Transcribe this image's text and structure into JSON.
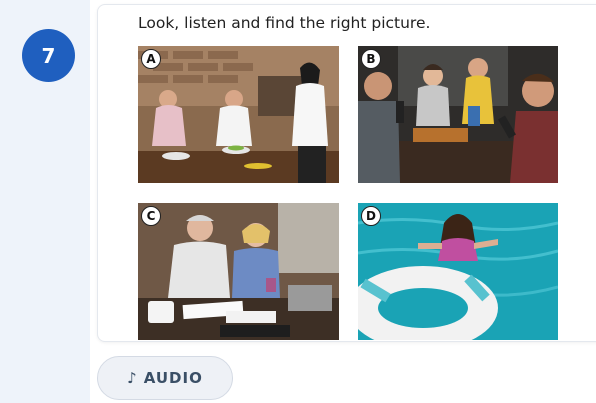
{
  "question": {
    "number": "7",
    "instruction": "Look, listen and find the right picture."
  },
  "pictures": [
    {
      "letter": "A",
      "icon": "restaurant-scene-image"
    },
    {
      "letter": "B",
      "icon": "karaoke-scene-image"
    },
    {
      "letter": "C",
      "icon": "worried-couple-bills-image"
    },
    {
      "letter": "D",
      "icon": "girl-swimming-pool-image"
    }
  ],
  "audio": {
    "icon": "music-note-icon",
    "icon_glyph": "♪",
    "label": "AUDIO"
  }
}
